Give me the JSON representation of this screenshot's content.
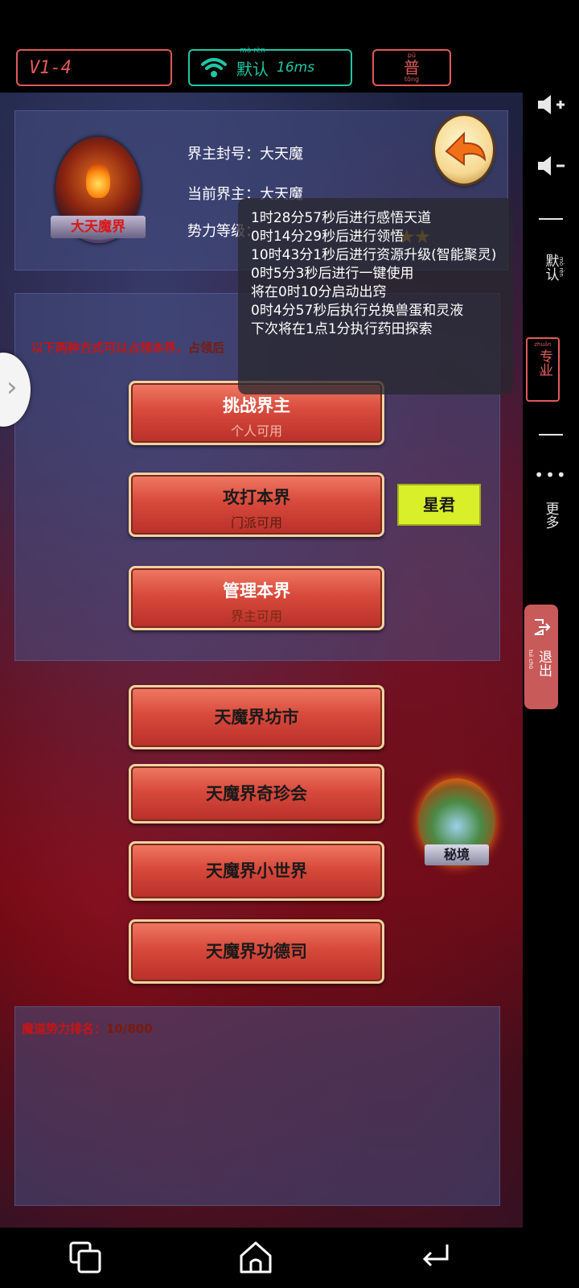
{
  "status_bar": {
    "version": "V1-4",
    "network_label": "默认",
    "network_pinyin": "mò rèn",
    "latency": "16ms",
    "mode_label": "普",
    "mode_pinyin_top": "pǔ",
    "mode_pinyin_bottom": "tōng"
  },
  "realm": {
    "emblem_label": "大天魔界",
    "title_label": "界主封号：",
    "title_value": "大天魔",
    "current_lord_label": "当前界主：",
    "current_lord_value": "大天魔",
    "power_label": "势力等级："
  },
  "notice_red": "以下两种方式可以占领本界，",
  "notice_tail": "占领后",
  "popup_lines": [
    "1时28分57秒后进行感悟天道",
    "0时14分29秒后进行领悟",
    "10时43分1秒后进行资源升级(智能聚灵)",
    "0时5分3秒后进行一键使用",
    "将在0时10分启动出窍",
    "0时4分57秒后执行兑换兽蛋和灵液",
    "下次将在1点1分执行药田探索"
  ],
  "actions": [
    {
      "label": "挑战界主",
      "sub": "个人可用"
    },
    {
      "label": "攻打本界",
      "sub": "门派可用"
    },
    {
      "label": "管理本界",
      "sub": "界主可用"
    }
  ],
  "star_lord_button": "星君",
  "menu": [
    "天魔界坊市",
    "天魔界奇珍会",
    "天魔界小世界",
    "天魔界功德司"
  ],
  "secret_realm_label": "秘境",
  "bottom_notice_red": "魔道势力排名：",
  "bottom_notice_tail": "10/800",
  "side_panel": {
    "default_label": "默认",
    "default_pinyin": "mò rèn",
    "pro_label": "专业",
    "pro_pinyin_top": "zhuān",
    "pro_pinyin_bottom": "yè",
    "more_label": "更多",
    "exit_label": "退出",
    "exit_pinyin": "tuì chū"
  },
  "colors": {
    "accent_red": "#e05a5a",
    "accent_teal": "#1fc7a4",
    "button_red": "#d84a3c",
    "star_lord_yellow": "#d8ef2a"
  }
}
